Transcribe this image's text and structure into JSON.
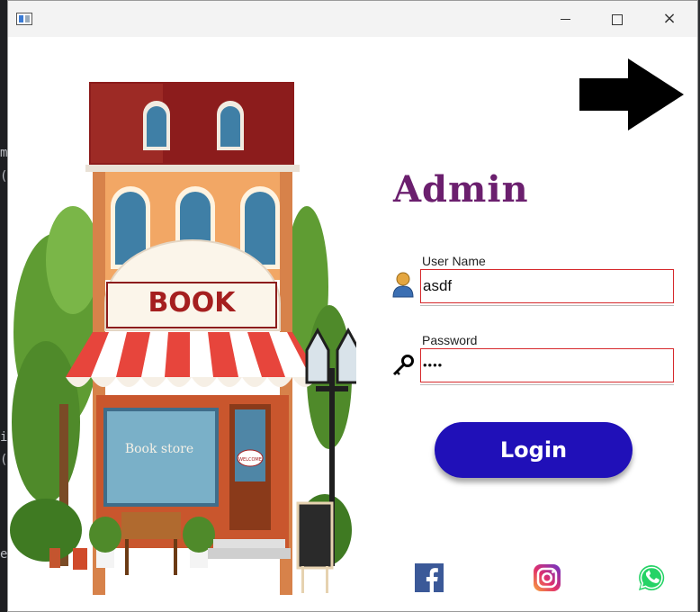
{
  "background": {
    "ide_glyphs": [
      "m",
      "(",
      "i",
      "(",
      "e"
    ]
  },
  "window": {
    "controls": {
      "minimize": "minimize-icon",
      "maximize": "maximize-icon",
      "close": "×"
    }
  },
  "illustration": {
    "sign": "BOOK",
    "window_text": "Book store",
    "door_sign": "WELCOME",
    "icon": "bookstore-illustration"
  },
  "form": {
    "title": "Admin",
    "username": {
      "label": "User Name",
      "value": "asdf",
      "icon": "user-icon"
    },
    "password": {
      "label": "Password",
      "value": "••••",
      "icon": "key-icon"
    },
    "login_label": "Login"
  },
  "social": [
    "facebook-icon",
    "instagram-icon",
    "whatsapp-icon"
  ],
  "colors": {
    "title": "#6b1f6e",
    "login_button": "#2010b8",
    "field_border": "#d6292c",
    "facebook": "#3b5998",
    "whatsapp": "#25d366"
  }
}
